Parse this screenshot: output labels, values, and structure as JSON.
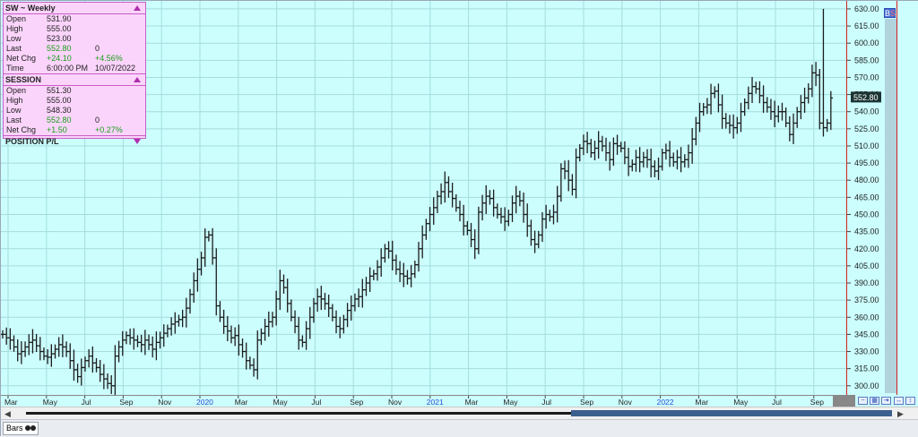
{
  "info_panel": {
    "title": "SW ~ Weekly",
    "rows": [
      {
        "label": "Open",
        "v1": "531.90",
        "v2": ""
      },
      {
        "label": "High",
        "v1": "555.00",
        "v2": ""
      },
      {
        "label": "Low",
        "v1": "523.00",
        "v2": ""
      },
      {
        "label": "Last",
        "v1": "552.80",
        "v2": "0"
      },
      {
        "label": "Net Chg",
        "v1": "+24.10",
        "v2": "+4.56%"
      },
      {
        "label": "Time",
        "v1": "6:00:00 PM",
        "v2": "10/07/2022"
      }
    ],
    "session_title": "SESSION",
    "session_rows": [
      {
        "label": "Open",
        "v1": "551.30",
        "v2": ""
      },
      {
        "label": "High",
        "v1": "555.00",
        "v2": ""
      },
      {
        "label": "Low",
        "v1": "548.30",
        "v2": ""
      },
      {
        "label": "Last",
        "v1": "552.80",
        "v2": "0"
      },
      {
        "label": "Net Chg",
        "v1": "+1.50",
        "v2": "+0.27%"
      }
    ],
    "position_title": "POSITION P/L"
  },
  "buttons": {
    "bs_b": "B",
    "bs_s": "S"
  },
  "bottom_tab": {
    "label": "Bars"
  },
  "colors": {
    "plot_bg": "#ccfefe",
    "grid": "#a5dcdc",
    "bar": "#1c1c1c",
    "last_label_bg": "#1c3434",
    "year_label": "#2a4bd8",
    "up_green": "#1a9d1a",
    "panel_bg": "#fbd4fb",
    "panel_border": "#c95ec9"
  },
  "chart_data": {
    "type": "ohlc",
    "title": "SW ~ Weekly",
    "last_value": 552.8,
    "last_value_label": "552.80",
    "y_axis": {
      "ylim": [
        292,
        637
      ],
      "ticks": [
        "630.00",
        "615.00",
        "600.00",
        "585.00",
        "570.00",
        "555.00",
        "540.00",
        "525.00",
        "510.00",
        "495.00",
        "480.00",
        "465.00",
        "450.00",
        "435.00",
        "420.00",
        "405.00",
        "390.00",
        "375.00",
        "360.00",
        "345.00",
        "330.00",
        "315.00",
        "300.00"
      ]
    },
    "x_axis": {
      "labels": [
        "Mar",
        "May",
        "Jul",
        "Sep",
        "Nov",
        "2020",
        "Mar",
        "May",
        "Jul",
        "Sep",
        "Nov",
        "2021",
        "Mar",
        "May",
        "Jul",
        "Sep",
        "Nov",
        "2022",
        "Mar",
        "May",
        "Jul",
        "Sep"
      ],
      "year_labels": [
        "2020",
        "2021",
        "2022"
      ],
      "range": [
        "2019-02",
        "2022-10"
      ]
    },
    "grid": true,
    "series": [
      {
        "name": "SW",
        "closes": [
          345,
          342,
          340,
          334,
          328,
          330,
          334,
          338,
          340,
          335,
          330,
          326,
          325,
          328,
          332,
          336,
          334,
          330,
          322,
          314,
          308,
          316,
          322,
          326,
          320,
          316,
          310,
          306,
          302,
          300,
          326,
          334,
          340,
          344,
          342,
          340,
          338,
          336,
          340,
          336,
          332,
          338,
          342,
          346,
          350,
          354,
          356,
          358,
          360,
          368,
          380,
          392,
          402,
          412,
          430,
          432,
          412,
          370,
          360,
          352,
          348,
          342,
          344,
          336,
          330,
          322,
          318,
          314,
          340,
          346,
          352,
          356,
          360,
          376,
          392,
          386,
          372,
          360,
          352,
          340,
          338,
          350,
          360,
          372,
          378,
          376,
          372,
          368,
          360,
          352,
          350,
          358,
          366,
          370,
          376,
          378,
          384,
          390,
          396,
          398,
          404,
          412,
          420,
          418,
          410,
          402,
          398,
          396,
          394,
          398,
          406,
          420,
          432,
          442,
          450,
          456,
          466,
          470,
          478,
          470,
          464,
          456,
          450,
          440,
          436,
          428,
          420,
          452,
          460,
          466,
          464,
          456,
          450,
          448,
          444,
          450,
          460,
          466,
          462,
          450,
          440,
          428,
          424,
          432,
          446,
          450,
          448,
          452,
          466,
          490,
          488,
          480,
          472,
          500,
          508,
          514,
          512,
          504,
          508,
          514,
          510,
          504,
          498,
          512,
          510,
          508,
          500,
          492,
          494,
          500,
          496,
          500,
          498,
          492,
          488,
          492,
          504,
          506,
          500,
          496,
          500,
          496,
          498,
          504,
          516,
          530,
          540,
          544,
          546,
          556,
          558,
          546,
          534,
          530,
          528,
          526,
          530,
          540,
          548,
          556,
          562,
          560,
          554,
          548,
          544,
          540,
          536,
          540,
          540,
          530,
          520,
          530,
          540,
          548,
          552,
          560,
          574,
          572,
          530,
          526,
          530,
          552
        ]
      }
    ]
  }
}
